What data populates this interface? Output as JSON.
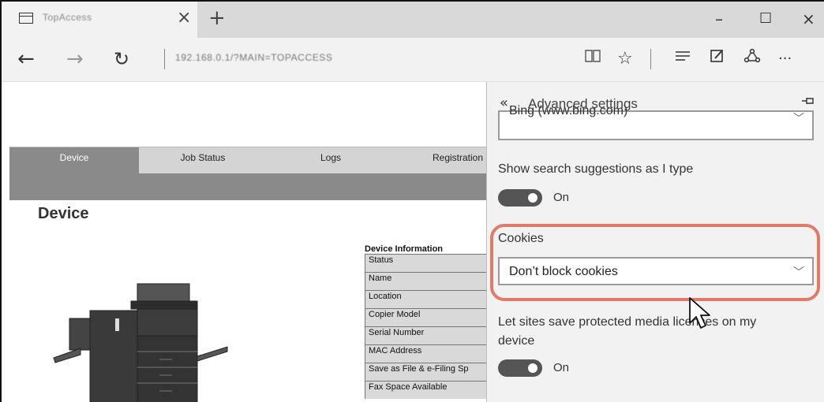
{
  "browser": {
    "tab": {
      "title": "TopAccess",
      "close_label": "×"
    },
    "new_tab_label": "+",
    "window_controls": {
      "minimize": "–",
      "maximize": "☐",
      "close": "×"
    },
    "nav": {
      "back": "←",
      "forward": "→",
      "refresh": "↻"
    },
    "address": "192.168.0.1/?MAIN=TOPACCESS",
    "toolbar_icons": [
      "reading-view-icon",
      "favorite-star-icon",
      "hub-icon",
      "web-note-icon",
      "share-icon",
      "more-icon"
    ],
    "more_label": "···"
  },
  "page": {
    "tabs": [
      "Device",
      "Job Status",
      "Logs",
      "Registration"
    ],
    "heading": "Device",
    "device_info": {
      "title": "Device Information",
      "rows": [
        "Status",
        "Name",
        "Location",
        "Copier Model",
        "Serial Number",
        "MAC Address",
        "Save as File & e-Filing Sp",
        "Fax Space Available"
      ]
    }
  },
  "panel": {
    "back_label": "«",
    "title": "Advanced settings",
    "search_engine_value": "Bing (www.bing.com)",
    "search_suggestions_label": "Show search suggestions as I type",
    "search_suggestions_state": "On",
    "cookies_label": "Cookies",
    "cookies_value": "Don’t block cookies",
    "media_licenses_label_line1": "Let sites save protected media licences on my",
    "media_licenses_label_line2": "device",
    "media_licenses_state": "On"
  },
  "colors": {
    "highlight": "#e27a6a",
    "toggle_on": "#555555",
    "tab_active": "#8a8a8a"
  }
}
